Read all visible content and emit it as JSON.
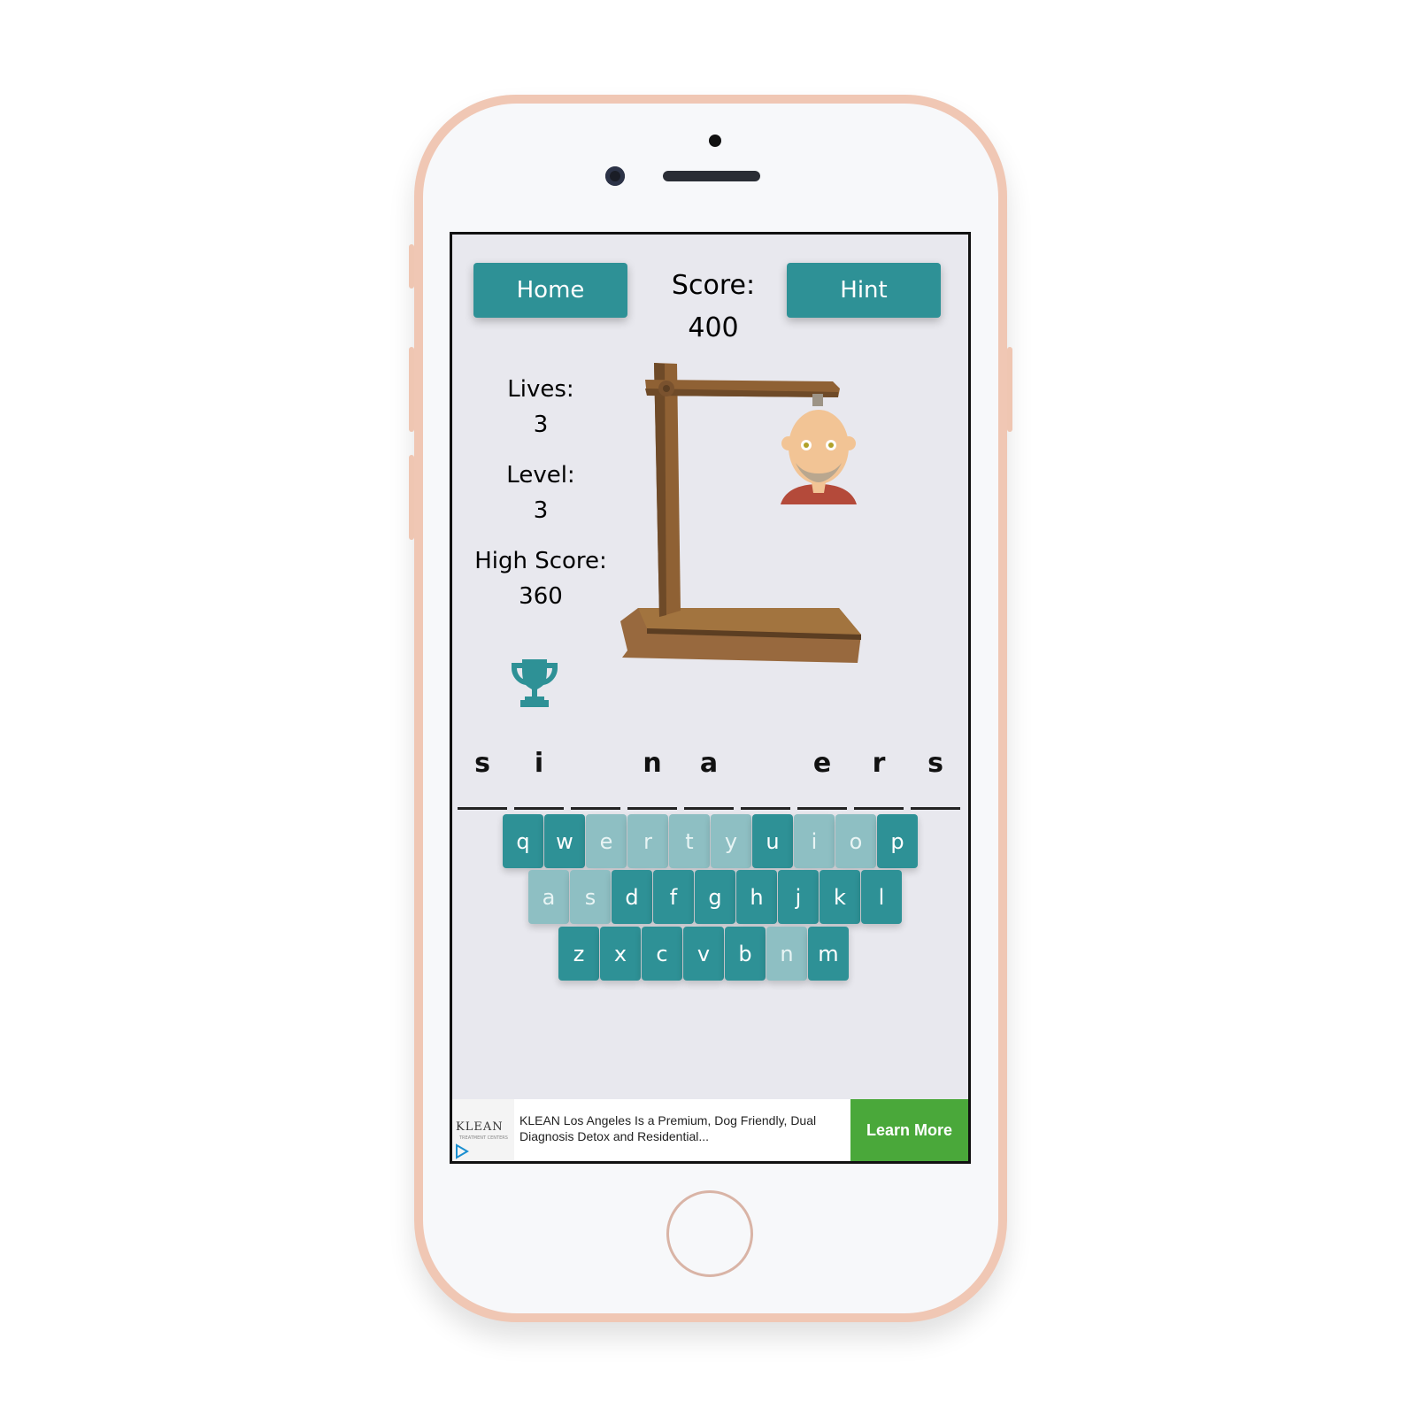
{
  "header": {
    "home_label": "Home",
    "hint_label": "Hint",
    "score_label": "Score:",
    "score_value": "400"
  },
  "stats": {
    "lives_label": "Lives:",
    "lives_value": "3",
    "level_label": "Level:",
    "level_value": "3",
    "high_label": "High Score:",
    "high_value": "360"
  },
  "word": {
    "slots": [
      "s",
      "i",
      "",
      "n",
      "a",
      "",
      "e",
      "r",
      "s"
    ]
  },
  "keyboard": {
    "rows": [
      [
        {
          "k": "q",
          "used": false
        },
        {
          "k": "w",
          "used": false
        },
        {
          "k": "e",
          "used": true
        },
        {
          "k": "r",
          "used": true
        },
        {
          "k": "t",
          "used": true
        },
        {
          "k": "y",
          "used": true
        },
        {
          "k": "u",
          "used": false
        },
        {
          "k": "i",
          "used": true
        },
        {
          "k": "o",
          "used": true
        },
        {
          "k": "p",
          "used": false
        }
      ],
      [
        {
          "k": "a",
          "used": true
        },
        {
          "k": "s",
          "used": true
        },
        {
          "k": "d",
          "used": false
        },
        {
          "k": "f",
          "used": false
        },
        {
          "k": "g",
          "used": false
        },
        {
          "k": "h",
          "used": false
        },
        {
          "k": "j",
          "used": false
        },
        {
          "k": "k",
          "used": false
        },
        {
          "k": "l",
          "used": false
        }
      ],
      [
        {
          "k": "z",
          "used": false
        },
        {
          "k": "x",
          "used": false
        },
        {
          "k": "c",
          "used": false
        },
        {
          "k": "v",
          "used": false
        },
        {
          "k": "b",
          "used": false
        },
        {
          "k": "n",
          "used": true
        },
        {
          "k": "m",
          "used": false
        }
      ]
    ]
  },
  "ad": {
    "logo_text": "KLEAN",
    "logo_sub": "TREATMENT CENTERS",
    "text": "KLEAN Los Angeles Is a Premium, Dog Friendly, Dual Diagnosis Detox and Residential...",
    "cta": "Learn More"
  },
  "colors": {
    "accent": "#2e9196",
    "used_key": "#8ebfc3",
    "ad_cta": "#4aa83a",
    "phone_frame": "#f0c7b4"
  }
}
